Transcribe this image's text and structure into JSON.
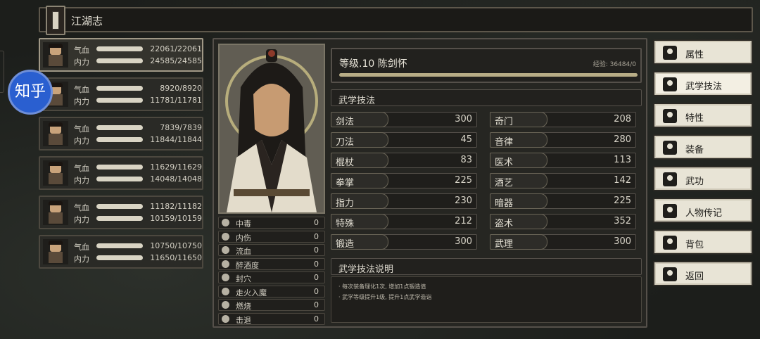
{
  "title": "江湖志",
  "watermark": "知乎",
  "stat_labels": {
    "hp": "气血",
    "mp": "内力"
  },
  "party": [
    {
      "hp": "22061/22061",
      "mp": "24585/24585",
      "active": true
    },
    {
      "hp": "8920/8920",
      "mp": "11781/11781"
    },
    {
      "hp": "7839/7839",
      "mp": "11844/11844"
    },
    {
      "hp": "11629/11629",
      "mp": "14048/14048"
    },
    {
      "hp": "11182/11182",
      "mp": "10159/10159"
    },
    {
      "hp": "10750/10750",
      "mp": "11650/11650"
    }
  ],
  "character": {
    "level_line": "等级.10 陈剑怀",
    "exp": "经验: 36484/0"
  },
  "section_title": "武学技法",
  "skills": [
    {
      "name": "剑法",
      "value": "300"
    },
    {
      "name": "奇门",
      "value": "208"
    },
    {
      "name": "刀法",
      "value": "45"
    },
    {
      "name": "音律",
      "value": "280"
    },
    {
      "name": "棍杖",
      "value": "83"
    },
    {
      "name": "医术",
      "value": "113"
    },
    {
      "name": "拳掌",
      "value": "225"
    },
    {
      "name": "酒艺",
      "value": "142"
    },
    {
      "name": "指力",
      "value": "230"
    },
    {
      "name": "暗器",
      "value": "225"
    },
    {
      "name": "特殊",
      "value": "212"
    },
    {
      "name": "盗术",
      "value": "352"
    },
    {
      "name": "锻造",
      "value": "300"
    },
    {
      "name": "武理",
      "value": "300"
    }
  ],
  "status_effects": [
    {
      "name": "中毒",
      "value": "0"
    },
    {
      "name": "内伤",
      "value": "0"
    },
    {
      "name": "流血",
      "value": "0"
    },
    {
      "name": "醉酒度",
      "value": "0"
    },
    {
      "name": "封穴",
      "value": "0"
    },
    {
      "name": "走火入魔",
      "value": "0"
    },
    {
      "name": "燃烧",
      "value": "0"
    },
    {
      "name": "击退",
      "value": "0"
    }
  ],
  "description": {
    "title": "武学技法说明",
    "lines": [
      "· 每次装备理化1次, 增加1点锻造值",
      "· 武学等级提升1级, 提升1点武学造诣"
    ]
  },
  "menu": [
    {
      "label": "属性",
      "icon": "person-icon"
    },
    {
      "label": "武学技法",
      "icon": "martial-skills-icon",
      "active": true
    },
    {
      "label": "特性",
      "icon": "traits-icon"
    },
    {
      "label": "装备",
      "icon": "sword-icon"
    },
    {
      "label": "武功",
      "icon": "scroll-icon"
    },
    {
      "label": "人物传记",
      "icon": "biography-icon"
    },
    {
      "label": "背包",
      "icon": "bag-icon"
    },
    {
      "label": "返回",
      "icon": "door-icon"
    }
  ]
}
